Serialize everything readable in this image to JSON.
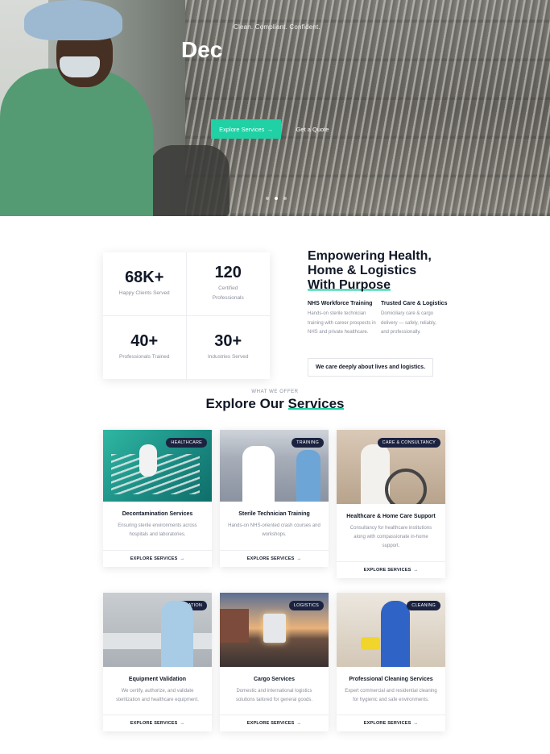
{
  "hero": {
    "tagline": "Clean. Compliant. Confident.",
    "title": "Dec",
    "primary_button": "Explore Services",
    "primary_arrow": "→",
    "secondary_button": "Get a Quote",
    "slides": 3,
    "active_slide": 2
  },
  "stats": [
    {
      "number": "68K+",
      "label": "Happy Clients Served"
    },
    {
      "number": "120",
      "label": "Certified Professionals"
    },
    {
      "number": "40+",
      "label": "Professionals Trained"
    },
    {
      "number": "30+",
      "label": "Industries Served"
    }
  ],
  "about": {
    "title_line1": "Empowering Health,",
    "title_line2": "Home & Logistics",
    "title_highlight": "With Purpose",
    "col1_title": "NHS Workforce Training",
    "col1_text": "Hands-on sterile technician training with career prospects in NHS and private healthcare.",
    "col2_title": "Trusted Care & Logistics",
    "col2_text": "Domiciliary care & cargo delivery — safely, reliably, and professionally.",
    "pill": "We care deeply about lives and logistics."
  },
  "services": {
    "eyebrow": "WHAT WE OFFER",
    "title_plain": "Explore Our ",
    "title_highlight": "Services",
    "cta_label": "EXPLORE SERVICES",
    "cta_arrow": "→",
    "cards": [
      {
        "badge": "HEALTHCARE",
        "title": "Decontamination Services",
        "text": "Ensuring sterile environments across hospitals and laboratories."
      },
      {
        "badge": "TRAINING",
        "title": "Sterile Technician Training",
        "text": "Hands-on NHS-oriented crash courses and workshops."
      },
      {
        "badge": "CARE & CONSULTANCY",
        "title": "Healthcare & Home Care Support",
        "text": "Consultancy for healthcare institutions along with compassionate in-home support."
      },
      {
        "badge": "VALIDATION",
        "title": "Equipment Validation",
        "text": "We certify, authorize, and validate sterilization and healthcare equipment."
      },
      {
        "badge": "LOGISTICS",
        "title": "Cargo Services",
        "text": "Domestic and international logistics solutions tailored for general goods."
      },
      {
        "badge": "CLEANING",
        "title": "Professional Cleaning Services",
        "text": "Expert commercial and residential cleaning for hygienic and safe environments."
      }
    ]
  },
  "colors": {
    "accent": "#1fd1a5",
    "badge_bg": "#1b2340",
    "heading": "#111827",
    "muted": "#8a8f9c"
  }
}
